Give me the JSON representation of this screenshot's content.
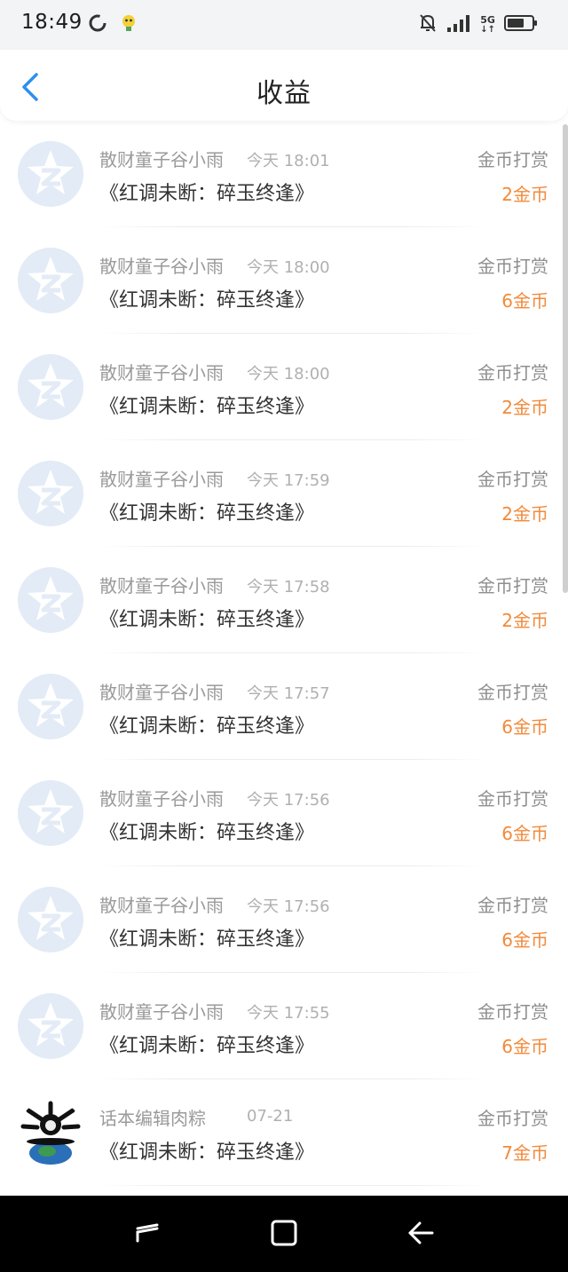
{
  "status_bar": {
    "time": "18:49",
    "network": "5G"
  },
  "header": {
    "title": "收益"
  },
  "icons": {
    "back": "chevron-left-icon",
    "avatar_default": "qzone-star-icon",
    "nav_recent": "recent-apps-icon",
    "nav_home": "home-icon",
    "nav_back": "back-arrow-icon"
  },
  "colors": {
    "accent_blue": "#2f8ff0",
    "reward_orange": "#f28a3a",
    "avatar_bg": "#e6edf7"
  },
  "records": [
    {
      "sender": "散财童子谷小雨",
      "time": "今天 18:01",
      "work": "《红调未断：碎玉终逢》",
      "type": "金币打赏",
      "amount": "2金币",
      "avatar": "default"
    },
    {
      "sender": "散财童子谷小雨",
      "time": "今天 18:00",
      "work": "《红调未断：碎玉终逢》",
      "type": "金币打赏",
      "amount": "6金币",
      "avatar": "default"
    },
    {
      "sender": "散财童子谷小雨",
      "time": "今天 18:00",
      "work": "《红调未断：碎玉终逢》",
      "type": "金币打赏",
      "amount": "2金币",
      "avatar": "default"
    },
    {
      "sender": "散财童子谷小雨",
      "time": "今天 17:59",
      "work": "《红调未断：碎玉终逢》",
      "type": "金币打赏",
      "amount": "2金币",
      "avatar": "default"
    },
    {
      "sender": "散财童子谷小雨",
      "time": "今天 17:58",
      "work": "《红调未断：碎玉终逢》",
      "type": "金币打赏",
      "amount": "2金币",
      "avatar": "default"
    },
    {
      "sender": "散财童子谷小雨",
      "time": "今天 17:57",
      "work": "《红调未断：碎玉终逢》",
      "type": "金币打赏",
      "amount": "6金币",
      "avatar": "default"
    },
    {
      "sender": "散财童子谷小雨",
      "time": "今天 17:56",
      "work": "《红调未断：碎玉终逢》",
      "type": "金币打赏",
      "amount": "6金币",
      "avatar": "default"
    },
    {
      "sender": "散财童子谷小雨",
      "time": "今天 17:56",
      "work": "《红调未断：碎玉终逢》",
      "type": "金币打赏",
      "amount": "6金币",
      "avatar": "default"
    },
    {
      "sender": "散财童子谷小雨",
      "time": "今天 17:55",
      "work": "《红调未断：碎玉终逢》",
      "type": "金币打赏",
      "amount": "6金币",
      "avatar": "default"
    },
    {
      "sender": "话本编辑肉粽",
      "time": "07-21",
      "work": "《红调未断：碎玉终逢》",
      "type": "金币打赏",
      "amount": "7金币",
      "avatar": "custom"
    }
  ]
}
